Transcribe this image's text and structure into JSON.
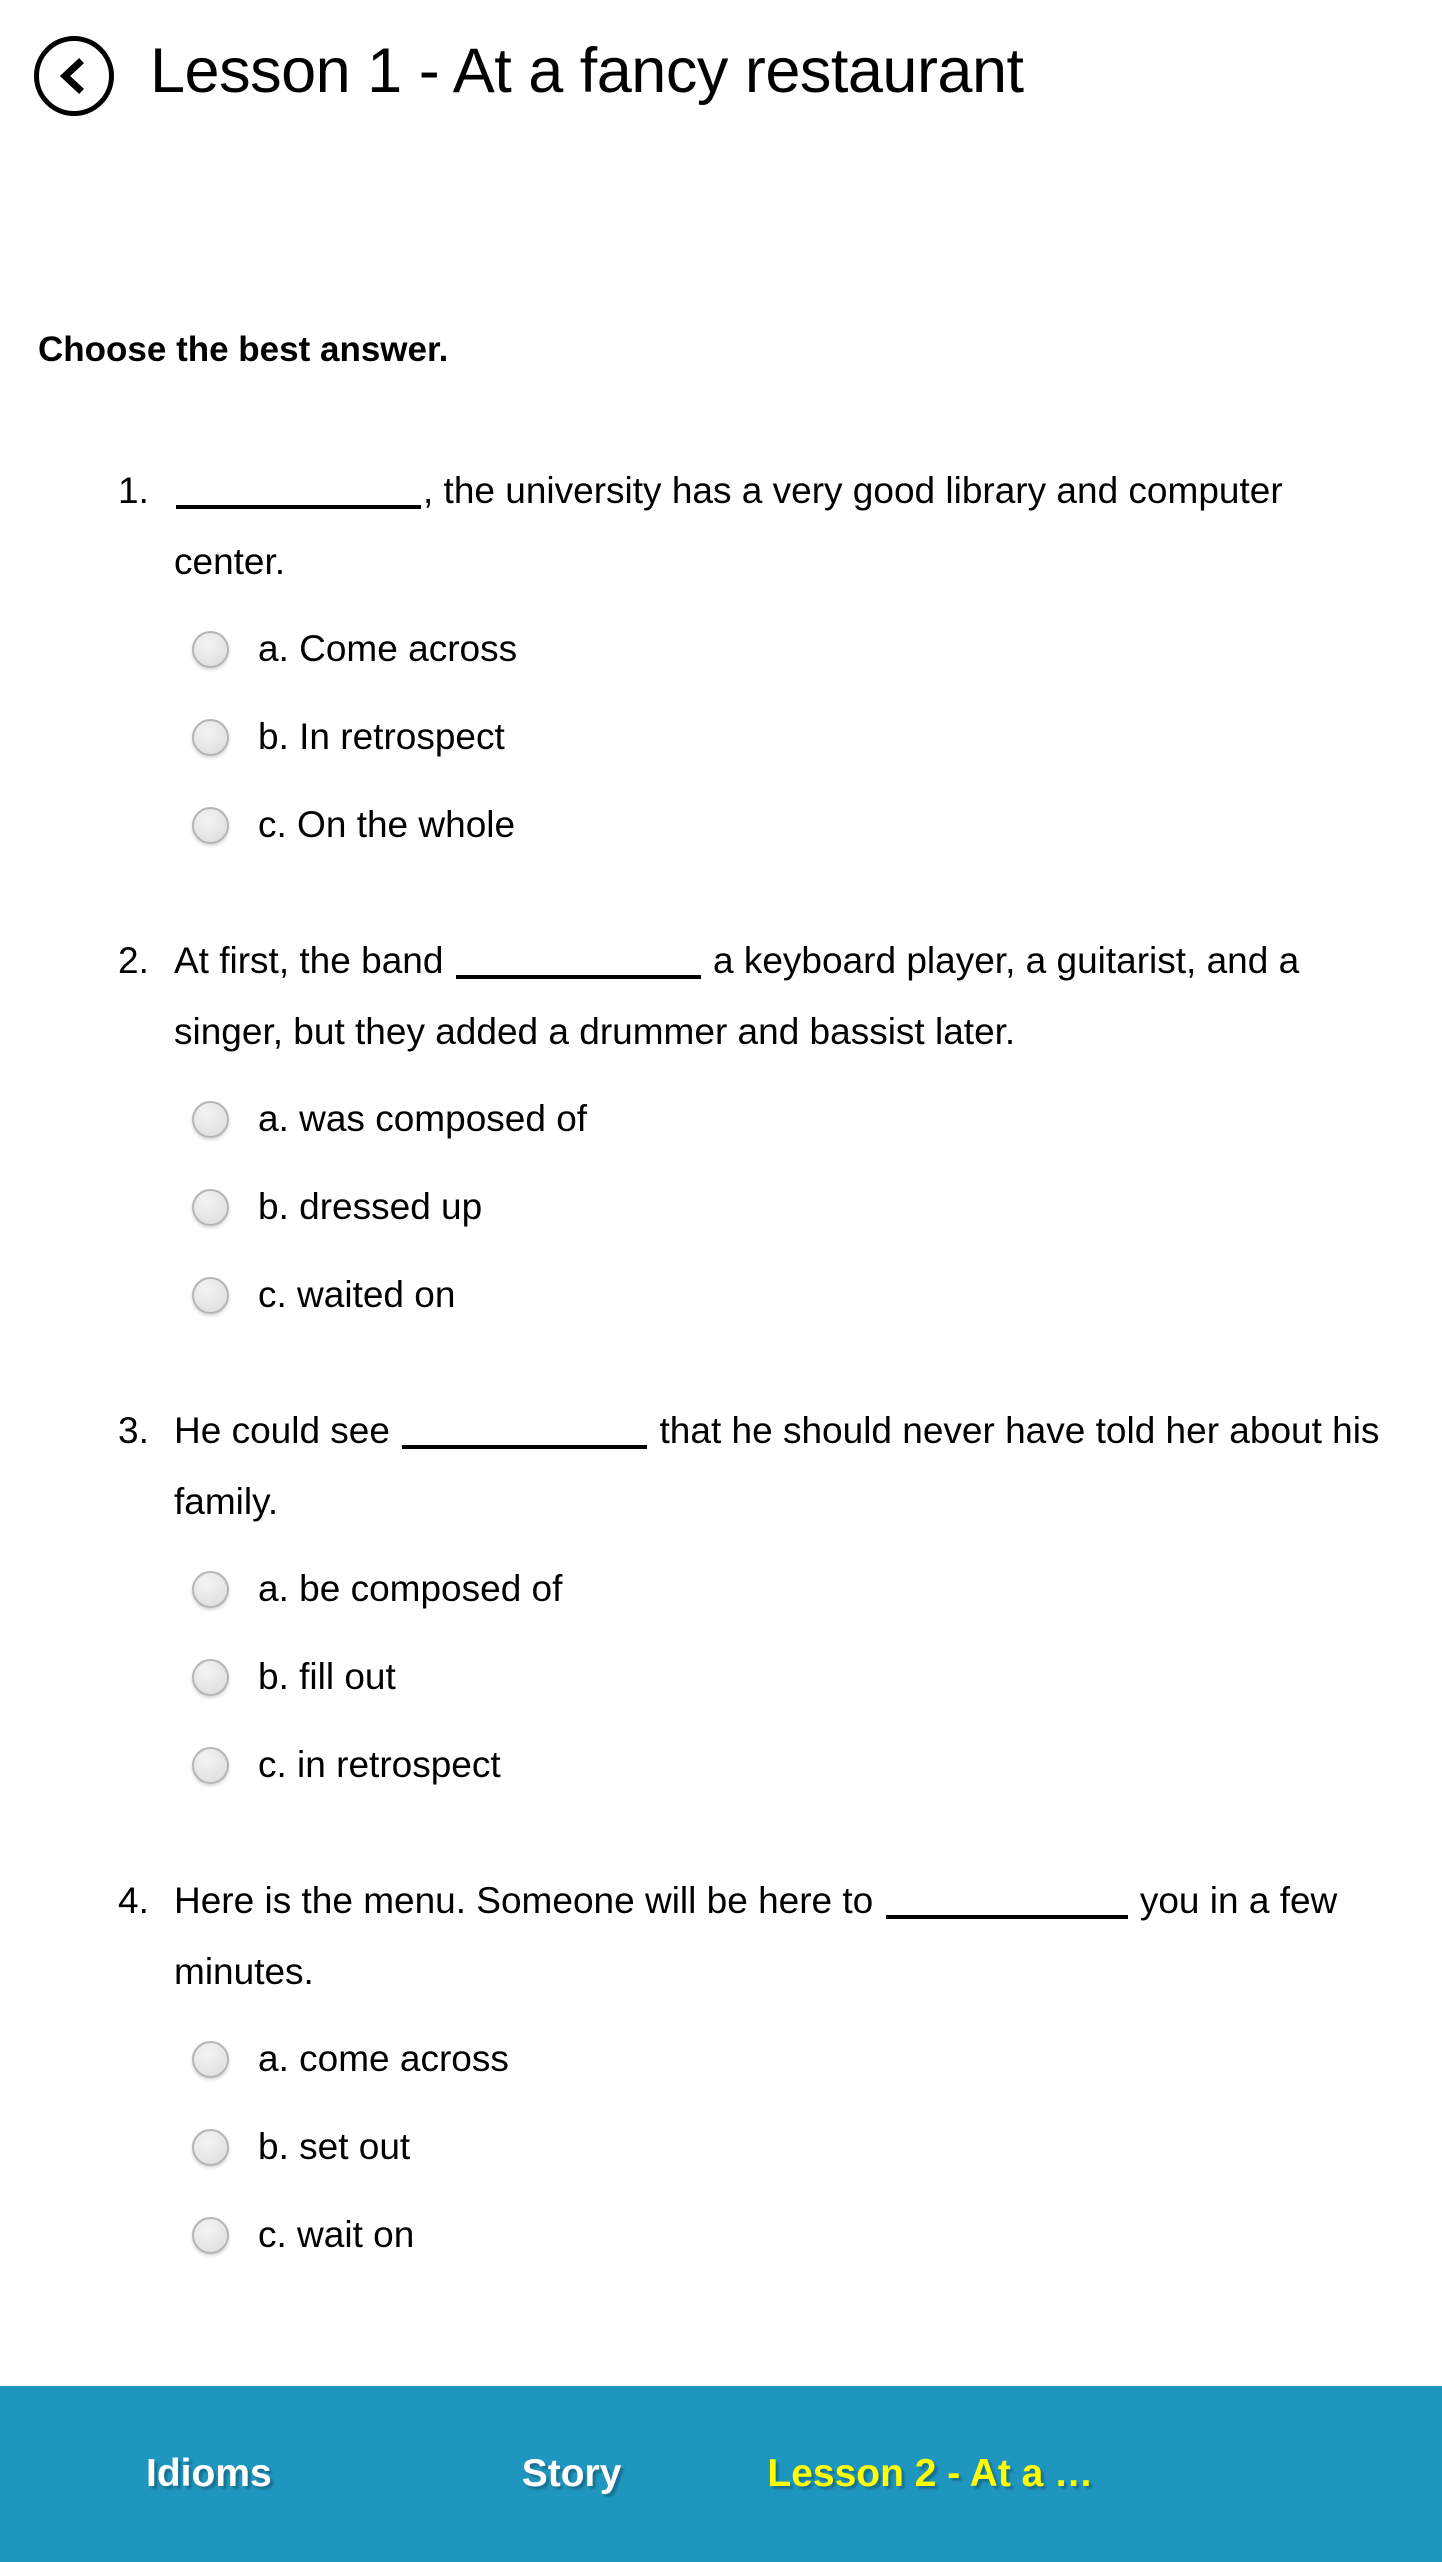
{
  "header": {
    "back_icon": "chevron-left-circle-icon",
    "title": "Lesson 1 - At a fancy restaurant"
  },
  "instruction": "Choose the best answer.",
  "questions": [
    {
      "number": "1.",
      "text_before": "",
      "blank": "__________",
      "text_after": ", the university has a very good library and computer center.",
      "options": [
        {
          "label": "a. Come across"
        },
        {
          "label": "b. In retrospect"
        },
        {
          "label": "c. On the whole"
        }
      ]
    },
    {
      "number": "2.",
      "text_before": "At first, the band ",
      "blank": "__________",
      "text_after": " a keyboard player, a guitarist, and a singer, but they added a drummer and bassist later.",
      "options": [
        {
          "label": "a. was composed of"
        },
        {
          "label": "b. dressed up"
        },
        {
          "label": "c. waited on"
        }
      ]
    },
    {
      "number": "3.",
      "text_before": "He could see ",
      "blank": "__________",
      "text_after": " that he should never have told her about his family.",
      "options": [
        {
          "label": "a. be composed of"
        },
        {
          "label": "b. fill out"
        },
        {
          "label": "c. in retrospect"
        }
      ]
    },
    {
      "number": "4.",
      "text_before": "Here is the menu. Someone will be here to ",
      "blank": "__________",
      "text_after": " you in a few minutes.",
      "options": [
        {
          "label": "a. come across"
        },
        {
          "label": "b. set out"
        },
        {
          "label": "c. wait on"
        }
      ]
    }
  ],
  "bottom_nav": {
    "background_color": "#1f96c0",
    "items": [
      {
        "label": "Idioms",
        "color": "#ffffff"
      },
      {
        "label": "Story",
        "color": "#ffffff"
      },
      {
        "label": "Lesson 2 - At a …",
        "color": "#ffff00"
      }
    ]
  }
}
